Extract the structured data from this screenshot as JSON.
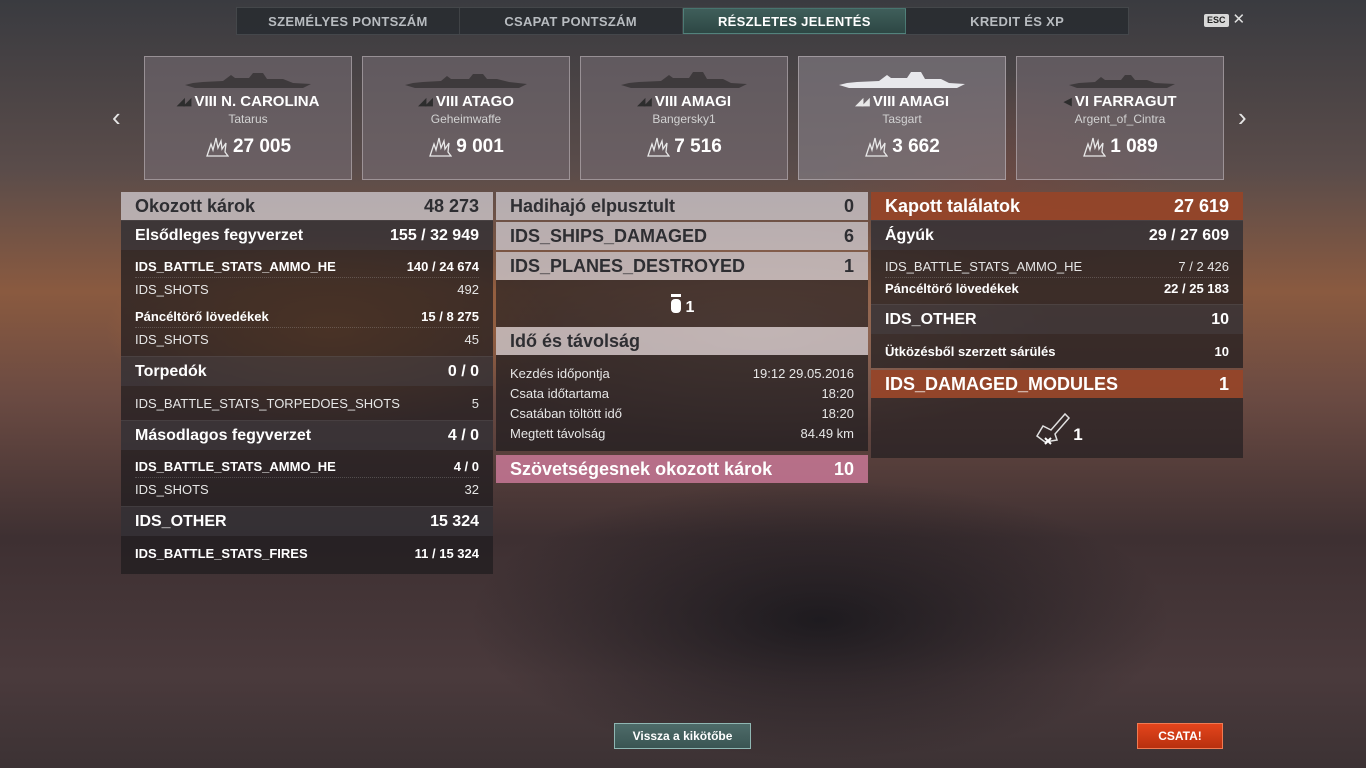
{
  "tabs": [
    {
      "label": "SZEMÉLYES PONTSZÁM",
      "active": false
    },
    {
      "label": "CSAPAT PONTSZÁM",
      "active": false
    },
    {
      "label": "RÉSZLETES JELENTÉS",
      "active": true
    },
    {
      "label": "KREDIT ÉS XP",
      "active": false
    }
  ],
  "esc": {
    "key": "ESC",
    "close": "✕"
  },
  "nav": {
    "prev": "‹",
    "next": "›"
  },
  "ships": [
    {
      "tier_name": "VIII N. CAROLINA",
      "player": "Tatarus",
      "damage": "27 005",
      "class_icon": "battleship-icon"
    },
    {
      "tier_name": "VIII ATAGO",
      "player": "Geheimwaffe",
      "damage": "9 001",
      "class_icon": "cruiser-icon"
    },
    {
      "tier_name": "VIII AMAGI",
      "player": "Bangersky1",
      "damage": "7 516",
      "class_icon": "battleship-icon"
    },
    {
      "tier_name": "VIII AMAGI",
      "player": "Tasgart",
      "damage": "3 662",
      "class_icon": "battleship-icon"
    },
    {
      "tier_name": "VI FARRAGUT",
      "player": "Argent_of_Cintra",
      "damage": "1 089",
      "class_icon": "destroyer-icon"
    }
  ],
  "left": {
    "header": {
      "label": "Okozott károk",
      "value": "48 273"
    },
    "primary": {
      "label": "Elsődleges fegyverzet",
      "value": "155 / 32 949"
    },
    "primary_rows": [
      {
        "label": "IDS_BATTLE_STATS_AMMO_HE",
        "value": "140 / 24 674"
      },
      {
        "label": "IDS_SHOTS",
        "value": "492"
      },
      {
        "label": "Páncéltörő lövedékek",
        "value": "15 / 8 275"
      },
      {
        "label": "IDS_SHOTS",
        "value": "45"
      }
    ],
    "torpedoes": {
      "label": "Torpedók",
      "value": "0 / 0"
    },
    "torpedo_rows": [
      {
        "label": "IDS_BATTLE_STATS_TORPEDOES_SHOTS",
        "value": "5"
      }
    ],
    "secondary": {
      "label": "Másodlagos fegyverzet",
      "value": "4 / 0"
    },
    "secondary_rows": [
      {
        "label": "IDS_BATTLE_STATS_AMMO_HE",
        "value": "4 / 0"
      },
      {
        "label": "IDS_SHOTS",
        "value": "32"
      }
    ],
    "other": {
      "label": "IDS_OTHER",
      "value": "15 324"
    },
    "other_rows": [
      {
        "label": "IDS_BATTLE_STATS_FIRES",
        "value": "11 / 15 324"
      }
    ]
  },
  "middle": {
    "destroyed": {
      "label": "Hadihajó elpusztult",
      "value": "0"
    },
    "damaged": {
      "label": "IDS_SHIPS_DAMAGED",
      "value": "6"
    },
    "planes": {
      "label": "IDS_PLANES_DESTROYED",
      "value": "1"
    },
    "planes_count": "1",
    "time": {
      "label": "Idő és távolság"
    },
    "time_rows": [
      {
        "label": "Kezdés időpontja",
        "value": "19:12  29.05.2016"
      },
      {
        "label": "Csata időtartama",
        "value": "18:20"
      },
      {
        "label": "Csatában töltött idő",
        "value": "18:20"
      },
      {
        "label": "Megtett távolság",
        "value": "84.49 km"
      }
    ],
    "ally": {
      "label": "Szövetségesnek okozott károk",
      "value": "10"
    }
  },
  "right": {
    "header": {
      "label": "Kapott találatok",
      "value": "27 619"
    },
    "guns": {
      "label": "Ágyúk",
      "value": "29 / 27 609"
    },
    "gun_rows": [
      {
        "label": "IDS_BATTLE_STATS_AMMO_HE",
        "value": "7 / 2 426"
      },
      {
        "label": "Páncéltörő lövedékek",
        "value": "22 / 25 183"
      }
    ],
    "other": {
      "label": "IDS_OTHER",
      "value": "10"
    },
    "other_rows": [
      {
        "label": "Ütközésből szerzett sárülés",
        "value": "10"
      }
    ],
    "modules": {
      "label": "IDS_DAMAGED_MODULES",
      "value": "1"
    },
    "modules_count": "1"
  },
  "buttons": {
    "port": "Vissza a kikötőbe",
    "battle": "CSATA!"
  }
}
